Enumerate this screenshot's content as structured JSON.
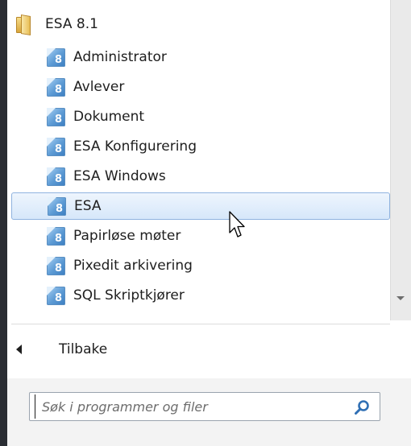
{
  "folder": {
    "label": "ESA 8.1",
    "icon": "folder-icon"
  },
  "programs": [
    {
      "label": "Administrator",
      "icon_digit": "8"
    },
    {
      "label": "Avlever",
      "icon_digit": "8"
    },
    {
      "label": "Dokument",
      "icon_digit": "8"
    },
    {
      "label": "ESA Konfigurering",
      "icon_digit": "8"
    },
    {
      "label": "ESA Windows",
      "icon_digit": "8"
    },
    {
      "label": "ESA",
      "icon_digit": "8",
      "highlighted": true
    },
    {
      "label": "Papirløse møter",
      "icon_digit": "8"
    },
    {
      "label": "Pixedit arkivering",
      "icon_digit": "8"
    },
    {
      "label": "SQL Skriptkjører",
      "icon_digit": "8"
    }
  ],
  "back": {
    "label": "Tilbake",
    "icon": "back-arrow-icon"
  },
  "search": {
    "placeholder": "Søk i programmer og filer",
    "value": "",
    "icon": "search-icon"
  },
  "colors": {
    "hover_border": "#8fb3df",
    "hover_fill": "#d6e7fa",
    "taskbar": "#2a2d33"
  }
}
